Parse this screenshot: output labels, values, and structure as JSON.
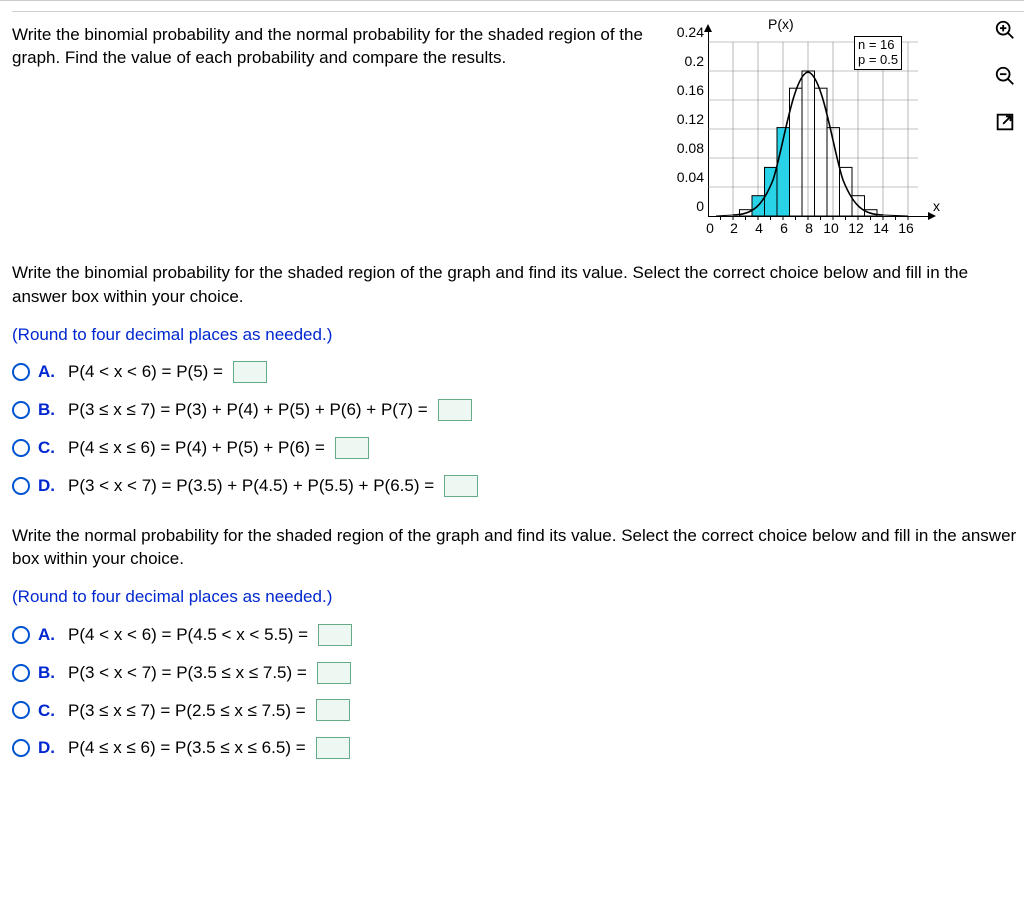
{
  "intro": "Write the binomial probability and the normal probability for the shaded region of the graph. Find the value of each probability and compare the results.",
  "q1": {
    "prompt": "Write the binomial probability for the shaded region of the graph and find its value. Select the correct choice below and fill in the answer box within your choice.",
    "round": "(Round to four decimal places as needed.)",
    "options": {
      "A": "P(4 < x < 6) = P(5) =",
      "B": "P(3 ≤ x ≤ 7) = P(3) + P(4) + P(5) + P(6) + P(7) =",
      "C": "P(4 ≤ x ≤ 6) = P(4) + P(5) + P(6) =",
      "D": "P(3 < x < 7) = P(3.5) + P(4.5) + P(5.5) + P(6.5) ="
    }
  },
  "q2": {
    "prompt": "Write the normal probability for the shaded region of the graph and find its value. Select the correct choice below and fill in the answer box within your choice.",
    "round": "(Round to four decimal places as needed.)",
    "options": {
      "A": "P(4 < x < 6) = P(4.5 < x < 5.5) =",
      "B": "P(3 < x < 7) = P(3.5 ≤ x ≤ 7.5) =",
      "C": "P(3 ≤ x ≤ 7) = P(2.5 ≤ x ≤ 7.5) =",
      "D": "P(4 ≤ x ≤ 6) = P(3.5 ≤ x ≤ 6.5) ="
    }
  },
  "labels": {
    "A": "A.",
    "B": "B.",
    "C": "C.",
    "D": "D."
  },
  "chart_data": {
    "type": "bar",
    "title": "P(x)",
    "xlabel": "x",
    "ylabel": "P(x)",
    "n": 16,
    "p": 0.5,
    "param_text_1": "n = 16",
    "param_text_2": "p = 0.5",
    "x_ticks": [
      0,
      2,
      4,
      6,
      8,
      10,
      12,
      14,
      16
    ],
    "y_ticks": [
      0,
      0.04,
      0.08,
      0.12,
      0.16,
      0.2,
      0.24
    ],
    "ylim": [
      0,
      0.24
    ],
    "xlim": [
      0,
      16
    ],
    "shaded_bars": {
      "x": [
        4,
        5,
        6
      ],
      "values": [
        0.028,
        0.067,
        0.122
      ]
    },
    "curve_mu": 8,
    "curve_sigma": 2,
    "curve_peak": 0.2
  },
  "tools": {
    "zoom_in": "zoom-in",
    "zoom_out": "zoom-out",
    "popout": "open-in-new"
  }
}
